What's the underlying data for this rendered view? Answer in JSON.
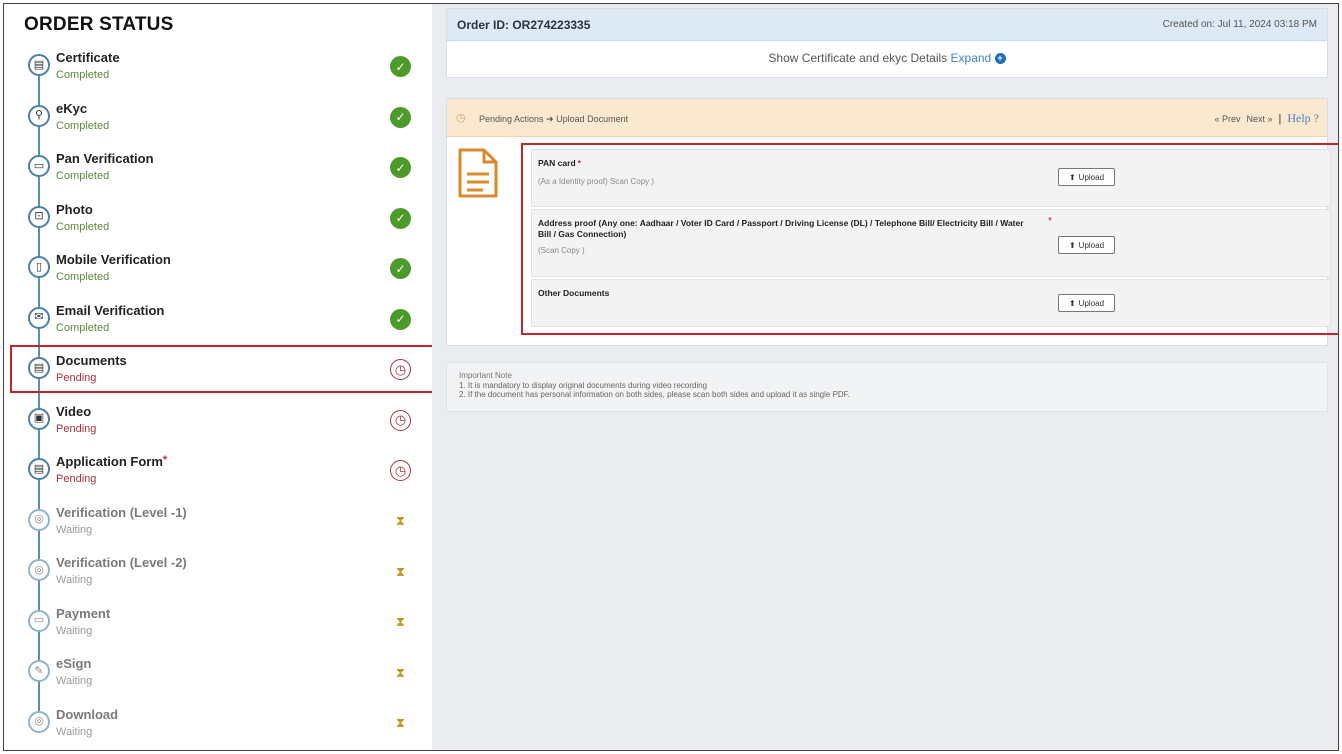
{
  "sidebar": {
    "title": "ORDER STATUS",
    "steps": [
      {
        "name": "Certificate",
        "status": "Completed",
        "icon": "certificate-icon",
        "glyph": "▤",
        "state": "done"
      },
      {
        "name": "eKyc",
        "status": "Completed",
        "icon": "search-icon",
        "glyph": "⚲",
        "state": "done"
      },
      {
        "name": "Pan Verification",
        "status": "Completed",
        "icon": "card-icon",
        "glyph": "▭",
        "state": "done"
      },
      {
        "name": "Photo",
        "status": "Completed",
        "icon": "camera-focus-icon",
        "glyph": "⊡",
        "state": "done"
      },
      {
        "name": "Mobile Verification",
        "status": "Completed",
        "icon": "mobile-icon",
        "glyph": "▯",
        "state": "done"
      },
      {
        "name": "Email Verification",
        "status": "Completed",
        "icon": "email-icon",
        "glyph": "✉",
        "state": "done"
      },
      {
        "name": "Documents",
        "status": "Pending",
        "icon": "document-icon",
        "glyph": "▤",
        "state": "pending"
      },
      {
        "name": "Video",
        "status": "Pending",
        "icon": "video-icon",
        "glyph": "▣",
        "state": "pending"
      },
      {
        "name": "Application Form",
        "status": "Pending",
        "icon": "form-icon",
        "glyph": "▤",
        "state": "pending",
        "required": "*"
      },
      {
        "name": "Verification (Level -1)",
        "status": "Waiting",
        "icon": "shield-icon",
        "glyph": "◎",
        "state": "waiting"
      },
      {
        "name": "Verification (Level -2)",
        "status": "Waiting",
        "icon": "shield-icon",
        "glyph": "◎",
        "state": "waiting"
      },
      {
        "name": "Payment",
        "status": "Waiting",
        "icon": "card-icon",
        "glyph": "▭",
        "state": "waiting"
      },
      {
        "name": "eSign",
        "status": "Waiting",
        "icon": "pen-icon",
        "glyph": "✎",
        "state": "waiting"
      },
      {
        "name": "Download",
        "status": "Waiting",
        "icon": "shield-icon",
        "glyph": "◎",
        "state": "waiting"
      }
    ]
  },
  "order": {
    "id_label": "Order ID: OR274223335",
    "created_on": "Created on: Jul 11, 2024 03:18 PM",
    "show_cert_text": "Show Certificate and ekyc Details ",
    "expand_label": "Expand"
  },
  "pending": {
    "breadcrumb": "Pending Actions ➜ Upload Document",
    "prev_label": "« Prev",
    "next_label": "Next »",
    "separator": "|",
    "help_label": "Help ?",
    "documents": [
      {
        "title": "PAN card",
        "required": "*",
        "subtitle": "(As a Identity proof) Scan Copy )"
      },
      {
        "title": "Address proof (Any one: Aadhaar / Voter ID Card / Passport / Driving License (DL) / Telephone Bill/ Electricity Bill / Water Bill / Gas Connection)",
        "required": "*",
        "subtitle": "(Scan Copy )"
      },
      {
        "title": "Other Documents",
        "required": "",
        "subtitle": ""
      }
    ],
    "upload_label": "Upload"
  },
  "note": {
    "title": "Important Note",
    "line1": "1. It is mandatory to display original documents during video recording",
    "line2": "2. If the document has personal information on both sides, please scan both sides and upload it as single PDF."
  },
  "colors": {
    "accent_blue": "#3f86c5",
    "completed_green": "#4c9a2a",
    "pending_red": "#a8323a",
    "waiting_gold": "#c8961d",
    "highlight_red": "#c0272d",
    "pending_header_bg": "#fbe9cf"
  }
}
